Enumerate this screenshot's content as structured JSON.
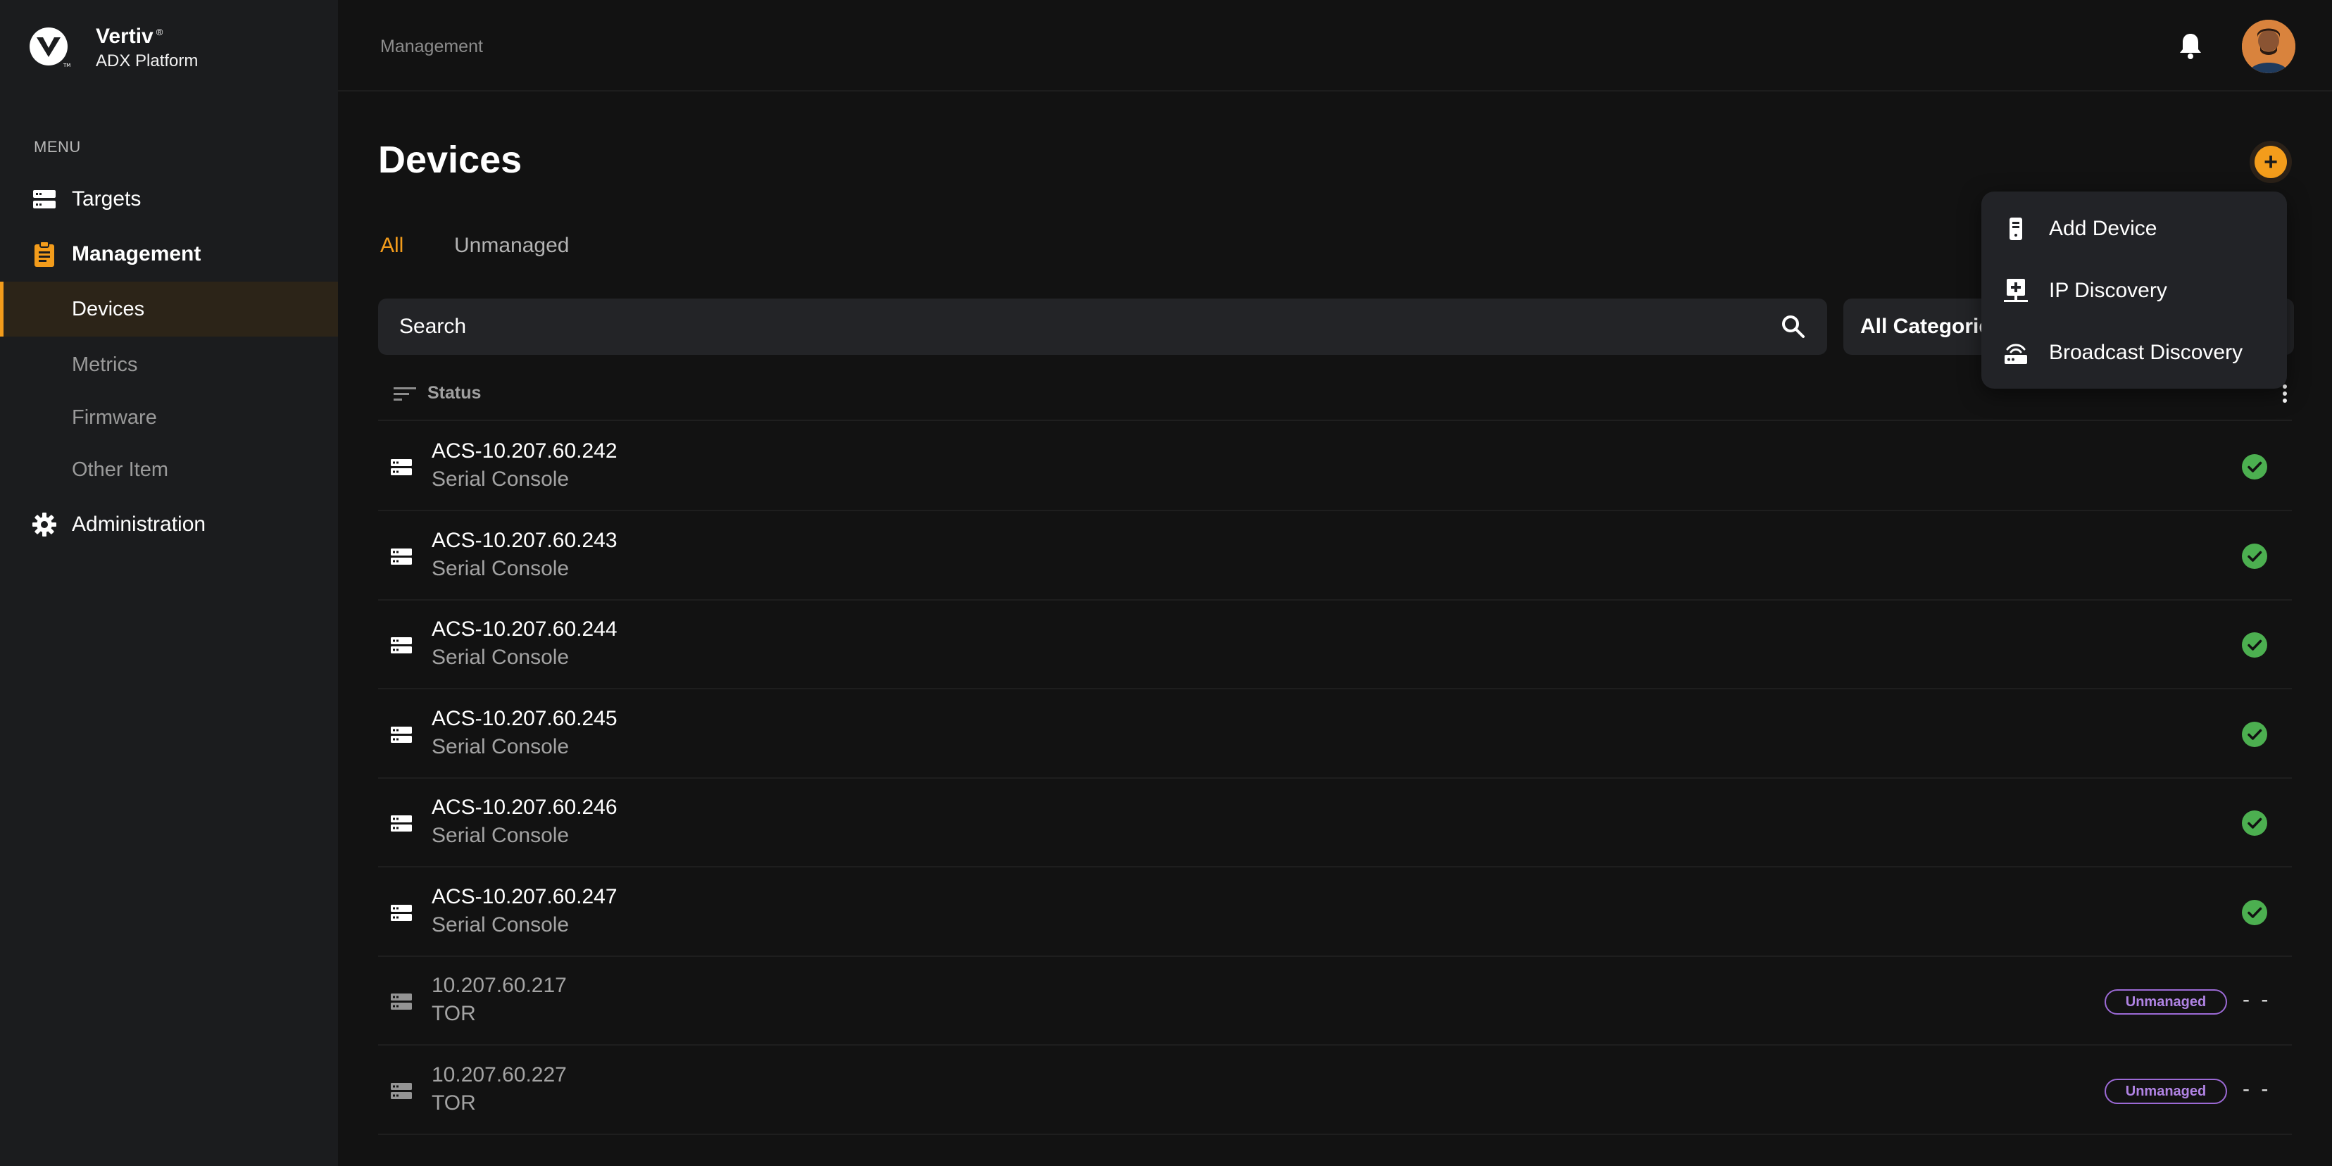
{
  "brand": {
    "name": "Vertiv",
    "registered": "®",
    "subtitle": "ADX Platform"
  },
  "sidebar": {
    "menu_label": "MENU",
    "items": [
      {
        "label": "Targets",
        "icon": "server-rack-icon"
      },
      {
        "label": "Management",
        "icon": "clipboard-icon"
      },
      {
        "label": "Devices"
      },
      {
        "label": "Metrics"
      },
      {
        "label": "Firmware"
      },
      {
        "label": "Other Item"
      },
      {
        "label": "Administration",
        "icon": "gear-icon"
      }
    ]
  },
  "header": {
    "breadcrumb": "Management"
  },
  "main": {
    "title": "Devices",
    "tabs": [
      {
        "label": "All",
        "active": true
      },
      {
        "label": "Unmanaged",
        "active": false
      }
    ],
    "search": {
      "placeholder": "Search"
    },
    "category": {
      "selected": "All Categories"
    },
    "list_header": {
      "status": "Status"
    },
    "rows": [
      {
        "name": "ACS-10.207.60.242",
        "type": "Serial Console",
        "status": "ok"
      },
      {
        "name": "ACS-10.207.60.243",
        "type": "Serial Console",
        "status": "ok"
      },
      {
        "name": "ACS-10.207.60.244",
        "type": "Serial Console",
        "status": "ok"
      },
      {
        "name": "ACS-10.207.60.245",
        "type": "Serial Console",
        "status": "ok"
      },
      {
        "name": "ACS-10.207.60.246",
        "type": "Serial Console",
        "status": "ok"
      },
      {
        "name": "ACS-10.207.60.247",
        "type": "Serial Console",
        "status": "ok"
      },
      {
        "name": "10.207.60.217",
        "type": "TOR",
        "status": "unmanaged",
        "badge": "Unmanaged",
        "value": "- -"
      },
      {
        "name": "10.207.60.227",
        "type": "TOR",
        "status": "unmanaged",
        "badge": "Unmanaged",
        "value": "- -"
      }
    ]
  },
  "dropdown": {
    "items": [
      {
        "label": "Add Device",
        "icon": "device-icon"
      },
      {
        "label": "IP Discovery",
        "icon": "network-add-icon"
      },
      {
        "label": "Broadcast Discovery",
        "icon": "broadcast-router-icon"
      }
    ]
  },
  "colors": {
    "accent": "#f39c1b",
    "success": "#4caf50",
    "unmanaged": "#9c6ad6",
    "background": "#121212",
    "sidebar": "#1b1c1e"
  }
}
